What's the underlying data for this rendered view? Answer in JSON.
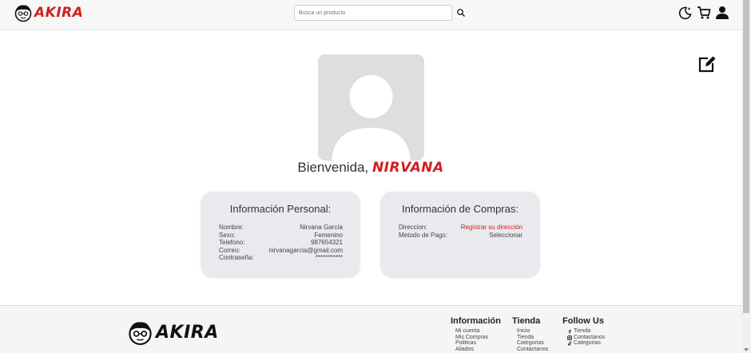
{
  "header": {
    "logo_text": "AKIRA",
    "search_placeholder": "Busca un producto",
    "icons": [
      "moon-icon",
      "cart-icon",
      "user-icon",
      "search-icon"
    ]
  },
  "profile": {
    "greeting": "Bienvenida,",
    "name": "NIRVANA"
  },
  "personal": {
    "title": "Información Personal:",
    "rows": [
      {
        "label": "Nombre:",
        "value": "Nirvana García"
      },
      {
        "label": "Sexo:",
        "value": "Femenino"
      },
      {
        "label": "Telefono:",
        "value": "987654321"
      },
      {
        "label": "Correo:",
        "value": "nirvanagarcia@gmail.com"
      },
      {
        "label": "Contraseña:",
        "value": "***********"
      }
    ]
  },
  "purchases": {
    "title": "Información de Compras:",
    "rows": [
      {
        "label": "Direccion:",
        "value": "Registrar su dirección"
      },
      {
        "label": "Metodo de Pago:",
        "value": "Seleccionar"
      }
    ]
  },
  "footer": {
    "logo_text": "AKIRA",
    "info": {
      "title": "Información",
      "items": [
        "Mi cuenta",
        "Mis Compras",
        "Politicas",
        "Aliados"
      ]
    },
    "store": {
      "title": "Tienda",
      "items": [
        "Inicio",
        "Tienda",
        "Categorias",
        "Contactanos"
      ]
    },
    "follow": {
      "title": "Follow Us",
      "items": [
        "Tienda",
        "Contactanos",
        "Categorias"
      ]
    }
  },
  "colors": {
    "accent": "#d0201f",
    "card": "#e9eaed",
    "avatar": "#dedede"
  }
}
